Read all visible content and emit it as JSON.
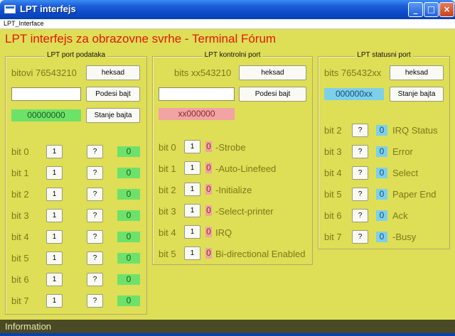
{
  "window": {
    "title": "LPT interfejs"
  },
  "menubar": {
    "label": "LPT_Interface"
  },
  "headline": "LPT interfejs za obrazovne svrhe - Terminal Fórum",
  "data_port": {
    "title": "LPT port podataka",
    "bits_label": "bitovi 76543210",
    "hex_button": "heksad",
    "input_value": "",
    "set_button": "Podesi bajt",
    "byte_display": "00000000",
    "state_button": "Stanje bajta",
    "rows": [
      {
        "label": "bit 0",
        "button": "1",
        "q": "?",
        "value": "0"
      },
      {
        "label": "bit 1",
        "button": "1",
        "q": "?",
        "value": "0"
      },
      {
        "label": "bit 2",
        "button": "1",
        "q": "?",
        "value": "0"
      },
      {
        "label": "bit 3",
        "button": "1",
        "q": "?",
        "value": "0"
      },
      {
        "label": "bit 4",
        "button": "1",
        "q": "?",
        "value": "0"
      },
      {
        "label": "bit 5",
        "button": "1",
        "q": "?",
        "value": "0"
      },
      {
        "label": "bit 6",
        "button": "1",
        "q": "?",
        "value": "0"
      },
      {
        "label": "bit 7",
        "button": "1",
        "q": "?",
        "value": "0"
      }
    ]
  },
  "control_port": {
    "title": "LPT kontrolni port",
    "bits_label": "bits xx543210",
    "hex_button": "heksad",
    "input_value": "",
    "set_button": "Podesi bajt",
    "byte_display": "xx000000",
    "rows": [
      {
        "label": "bit 0",
        "button": "1",
        "value": "0",
        "name": "-Strobe"
      },
      {
        "label": "bit 1",
        "button": "1",
        "value": "0",
        "name": "-Auto-Linefeed"
      },
      {
        "label": "bit 2",
        "button": "1",
        "value": "0",
        "name": "-Initialize"
      },
      {
        "label": "bit 3",
        "button": "1",
        "value": "0",
        "name": "-Select-printer"
      },
      {
        "label": "bit 4",
        "button": "1",
        "value": "0",
        "name": "IRQ"
      },
      {
        "label": "bit 5",
        "button": "1",
        "value": "0",
        "name": "Bi-directional Enabled"
      }
    ]
  },
  "status_port": {
    "title": "LPT statusni port",
    "bits_label": "bits 765432xx",
    "hex_button": "heksad",
    "byte_display": "000000xx",
    "state_button": "Stanje bajta",
    "rows": [
      {
        "label": "bit 2",
        "q": "?",
        "value": "0",
        "name": "IRQ Status"
      },
      {
        "label": "bit 3",
        "q": "?",
        "value": "0",
        "name": "Error"
      },
      {
        "label": "bit 4",
        "q": "?",
        "value": "0",
        "name": "Select"
      },
      {
        "label": "bit 5",
        "q": "?",
        "value": "0",
        "name": "Paper End"
      },
      {
        "label": "bit 6",
        "q": "?",
        "value": "0",
        "name": "Ack"
      },
      {
        "label": "bit 7",
        "q": "?",
        "value": "0",
        "name": "-Busy"
      }
    ]
  },
  "statusbar": {
    "text": "Information"
  },
  "colors": {
    "background": "#dede57",
    "headline": "#e0180c",
    "green": "#6de26a",
    "pink": "#f2a3a3",
    "blue": "#7dd0ea"
  },
  "icons": {
    "app": "window-icon",
    "minimize": "minimize-icon",
    "maximize": "maximize-icon",
    "close": "close-icon"
  }
}
